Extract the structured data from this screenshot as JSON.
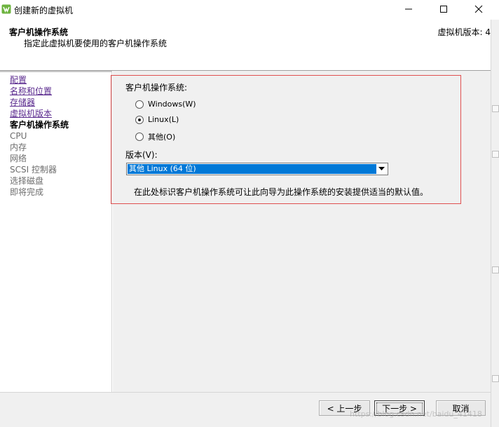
{
  "window": {
    "title": "创建新的虚拟机",
    "icons": {
      "app": "vsphere-logo-icon",
      "minimize": "minimize-icon",
      "maximize": "maximize-icon",
      "close": "close-icon"
    }
  },
  "header": {
    "title": "客户机操作系统",
    "subtitle": "指定此虚拟机要使用的客户机操作系统",
    "version": "虚拟机版本: 4"
  },
  "sidebar": {
    "items": [
      {
        "label": "配置",
        "state": "link"
      },
      {
        "label": "名称和位置",
        "state": "link"
      },
      {
        "label": "存储器",
        "state": "link"
      },
      {
        "label": "虚拟机版本",
        "state": "link"
      },
      {
        "label": "客户机操作系统",
        "state": "current"
      },
      {
        "label": "CPU",
        "state": "disabled"
      },
      {
        "label": "内存",
        "state": "disabled"
      },
      {
        "label": "网络",
        "state": "disabled"
      },
      {
        "label": "SCSI 控制器",
        "state": "disabled"
      },
      {
        "label": "选择磁盘",
        "state": "disabled"
      },
      {
        "label": "即将完成",
        "state": "disabled"
      }
    ]
  },
  "guest_os": {
    "group_label": "客户机操作系统:",
    "options": [
      {
        "label": "Windows(W)",
        "checked": false
      },
      {
        "label": "Linux(L)",
        "checked": true
      },
      {
        "label": "其他(O)",
        "checked": false
      }
    ],
    "version_label": "版本(V):",
    "version_selected": "其他 Linux (64 位)",
    "hint": "在此处标识客户机操作系统可让此向导为此操作系统的安装提供适当的默认值。"
  },
  "footer": {
    "back_label": "< 上一步",
    "next_label": "下一步 >",
    "cancel_label": "取消",
    "watermark": "https://blog.csdn.net/baidu_41418"
  },
  "colors": {
    "link": "#5b2b8f",
    "highlight": "#0078d7",
    "annotation_border": "#e05050",
    "content_bg": "#f0f0f0"
  }
}
